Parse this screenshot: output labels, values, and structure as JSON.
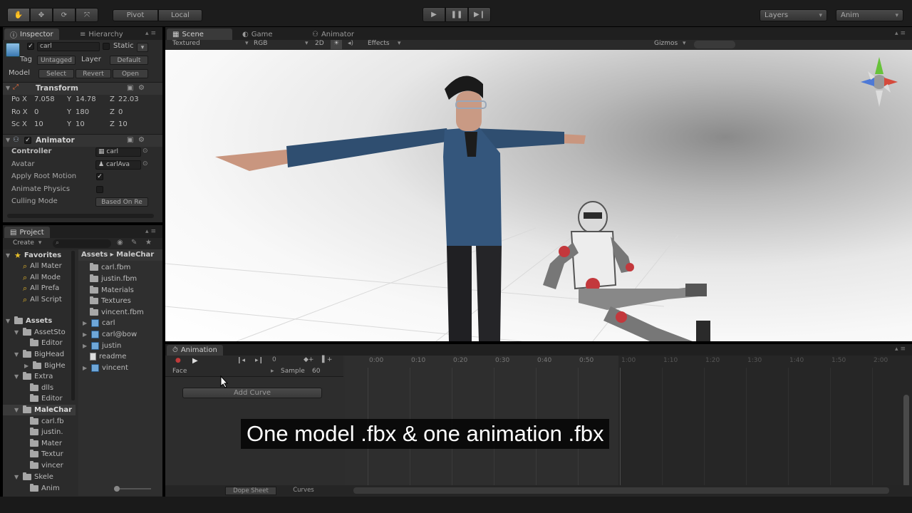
{
  "toolbar": {
    "transform_tools": [
      "hand-icon",
      "move-icon",
      "rotate-icon",
      "scale-icon"
    ],
    "pivot_label": "Pivot",
    "local_label": "Local",
    "layers_label": "Layers",
    "layout_label": "Anim"
  },
  "inspector": {
    "tab_inspector": "Inspector",
    "tab_hierarchy": "Hierarchy",
    "object_name": "carl",
    "static_label": "Static",
    "tag_label": "Tag",
    "tag_value": "Untagged",
    "layer_label": "Layer",
    "layer_value": "Default",
    "model_label": "Model",
    "select_btn": "Select",
    "revert_btn": "Revert",
    "open_btn": "Open",
    "transform": {
      "title": "Transform",
      "pos_label": "Po",
      "pos_x": "7.058",
      "pos_y": "14.78",
      "pos_z": "22.03",
      "rot_label": "Ro",
      "rot_x": "0",
      "rot_y": "180",
      "rot_z": "0",
      "scale_label": "Sc",
      "scale_x": "10",
      "scale_y": "10",
      "scale_z": "10"
    },
    "animator": {
      "title": "Animator",
      "controller_label": "Controller",
      "controller_value": "carl",
      "avatar_label": "Avatar",
      "avatar_value": "carlAva",
      "apply_root_motion_label": "Apply Root Motion",
      "animate_physics_label": "Animate Physics",
      "culling_mode_label": "Culling Mode",
      "culling_mode_value": "Based On Re"
    }
  },
  "project": {
    "tab_label": "Project",
    "create_label": "Create",
    "favorites_label": "Favorites",
    "favorites": [
      "All Mater",
      "All Mode",
      "All Prefa",
      "All Script"
    ],
    "assets_label": "Assets",
    "asset_tree": [
      {
        "label": "AssetSto",
        "indent": 1,
        "open": true
      },
      {
        "label": "Editor",
        "indent": 2,
        "open": false
      },
      {
        "label": "BigHead",
        "indent": 1,
        "open": true
      },
      {
        "label": "BigHe",
        "indent": 2,
        "open": true
      },
      {
        "label": "Extra",
        "indent": 1,
        "open": true
      },
      {
        "label": "dlls",
        "indent": 2,
        "open": false
      },
      {
        "label": "Editor",
        "indent": 2,
        "open": false
      },
      {
        "label": "MaleChar",
        "indent": 1,
        "open": true
      },
      {
        "label": "carl.fb",
        "indent": 2,
        "open": false
      },
      {
        "label": "justin.",
        "indent": 2,
        "open": false
      },
      {
        "label": "Mater",
        "indent": 2,
        "open": false
      },
      {
        "label": "Textur",
        "indent": 2,
        "open": false
      },
      {
        "label": "vincer",
        "indent": 2,
        "open": false
      },
      {
        "label": "Skele",
        "indent": 1,
        "open": true
      },
      {
        "label": "Anim",
        "indent": 2,
        "open": false
      }
    ],
    "breadcrumb_root": "Assets",
    "breadcrumb_child": "MaleChar",
    "files": [
      {
        "label": "carl.fbm",
        "icon": "folder"
      },
      {
        "label": "justin.fbm",
        "icon": "folder"
      },
      {
        "label": "Materials",
        "icon": "folder"
      },
      {
        "label": "Textures",
        "icon": "folder"
      },
      {
        "label": "vincent.fbm",
        "icon": "folder"
      },
      {
        "label": "carl",
        "icon": "prefab"
      },
      {
        "label": "carl@bow",
        "icon": "prefab"
      },
      {
        "label": "justin",
        "icon": "prefab"
      },
      {
        "label": "readme",
        "icon": "doc"
      },
      {
        "label": "vincent",
        "icon": "prefab"
      }
    ]
  },
  "scene": {
    "tab_scene": "Scene",
    "tab_game": "Game",
    "tab_animator": "Animator",
    "textured_label": "Textured",
    "rgb_label": "RGB",
    "mode_2d_label": "2D",
    "effects_label": "Effects",
    "gizmos_label": "Gizmos"
  },
  "animation": {
    "tab_label": "Animation",
    "frame_value": "0",
    "clip_label": "Face",
    "sample_label": "Sample",
    "sample_value": "60",
    "add_curve_label": "Add Curve",
    "ticks": [
      "0:00",
      "0:10",
      "0:20",
      "0:30",
      "0:40",
      "0:50",
      "1:00",
      "1:10",
      "1:20",
      "1:30",
      "1:40",
      "1:50",
      "2:00"
    ],
    "dope_sheet_label": "Dope Sheet",
    "curves_label": "Curves"
  },
  "subtitle": "One model .fbx & one animation .fbx"
}
